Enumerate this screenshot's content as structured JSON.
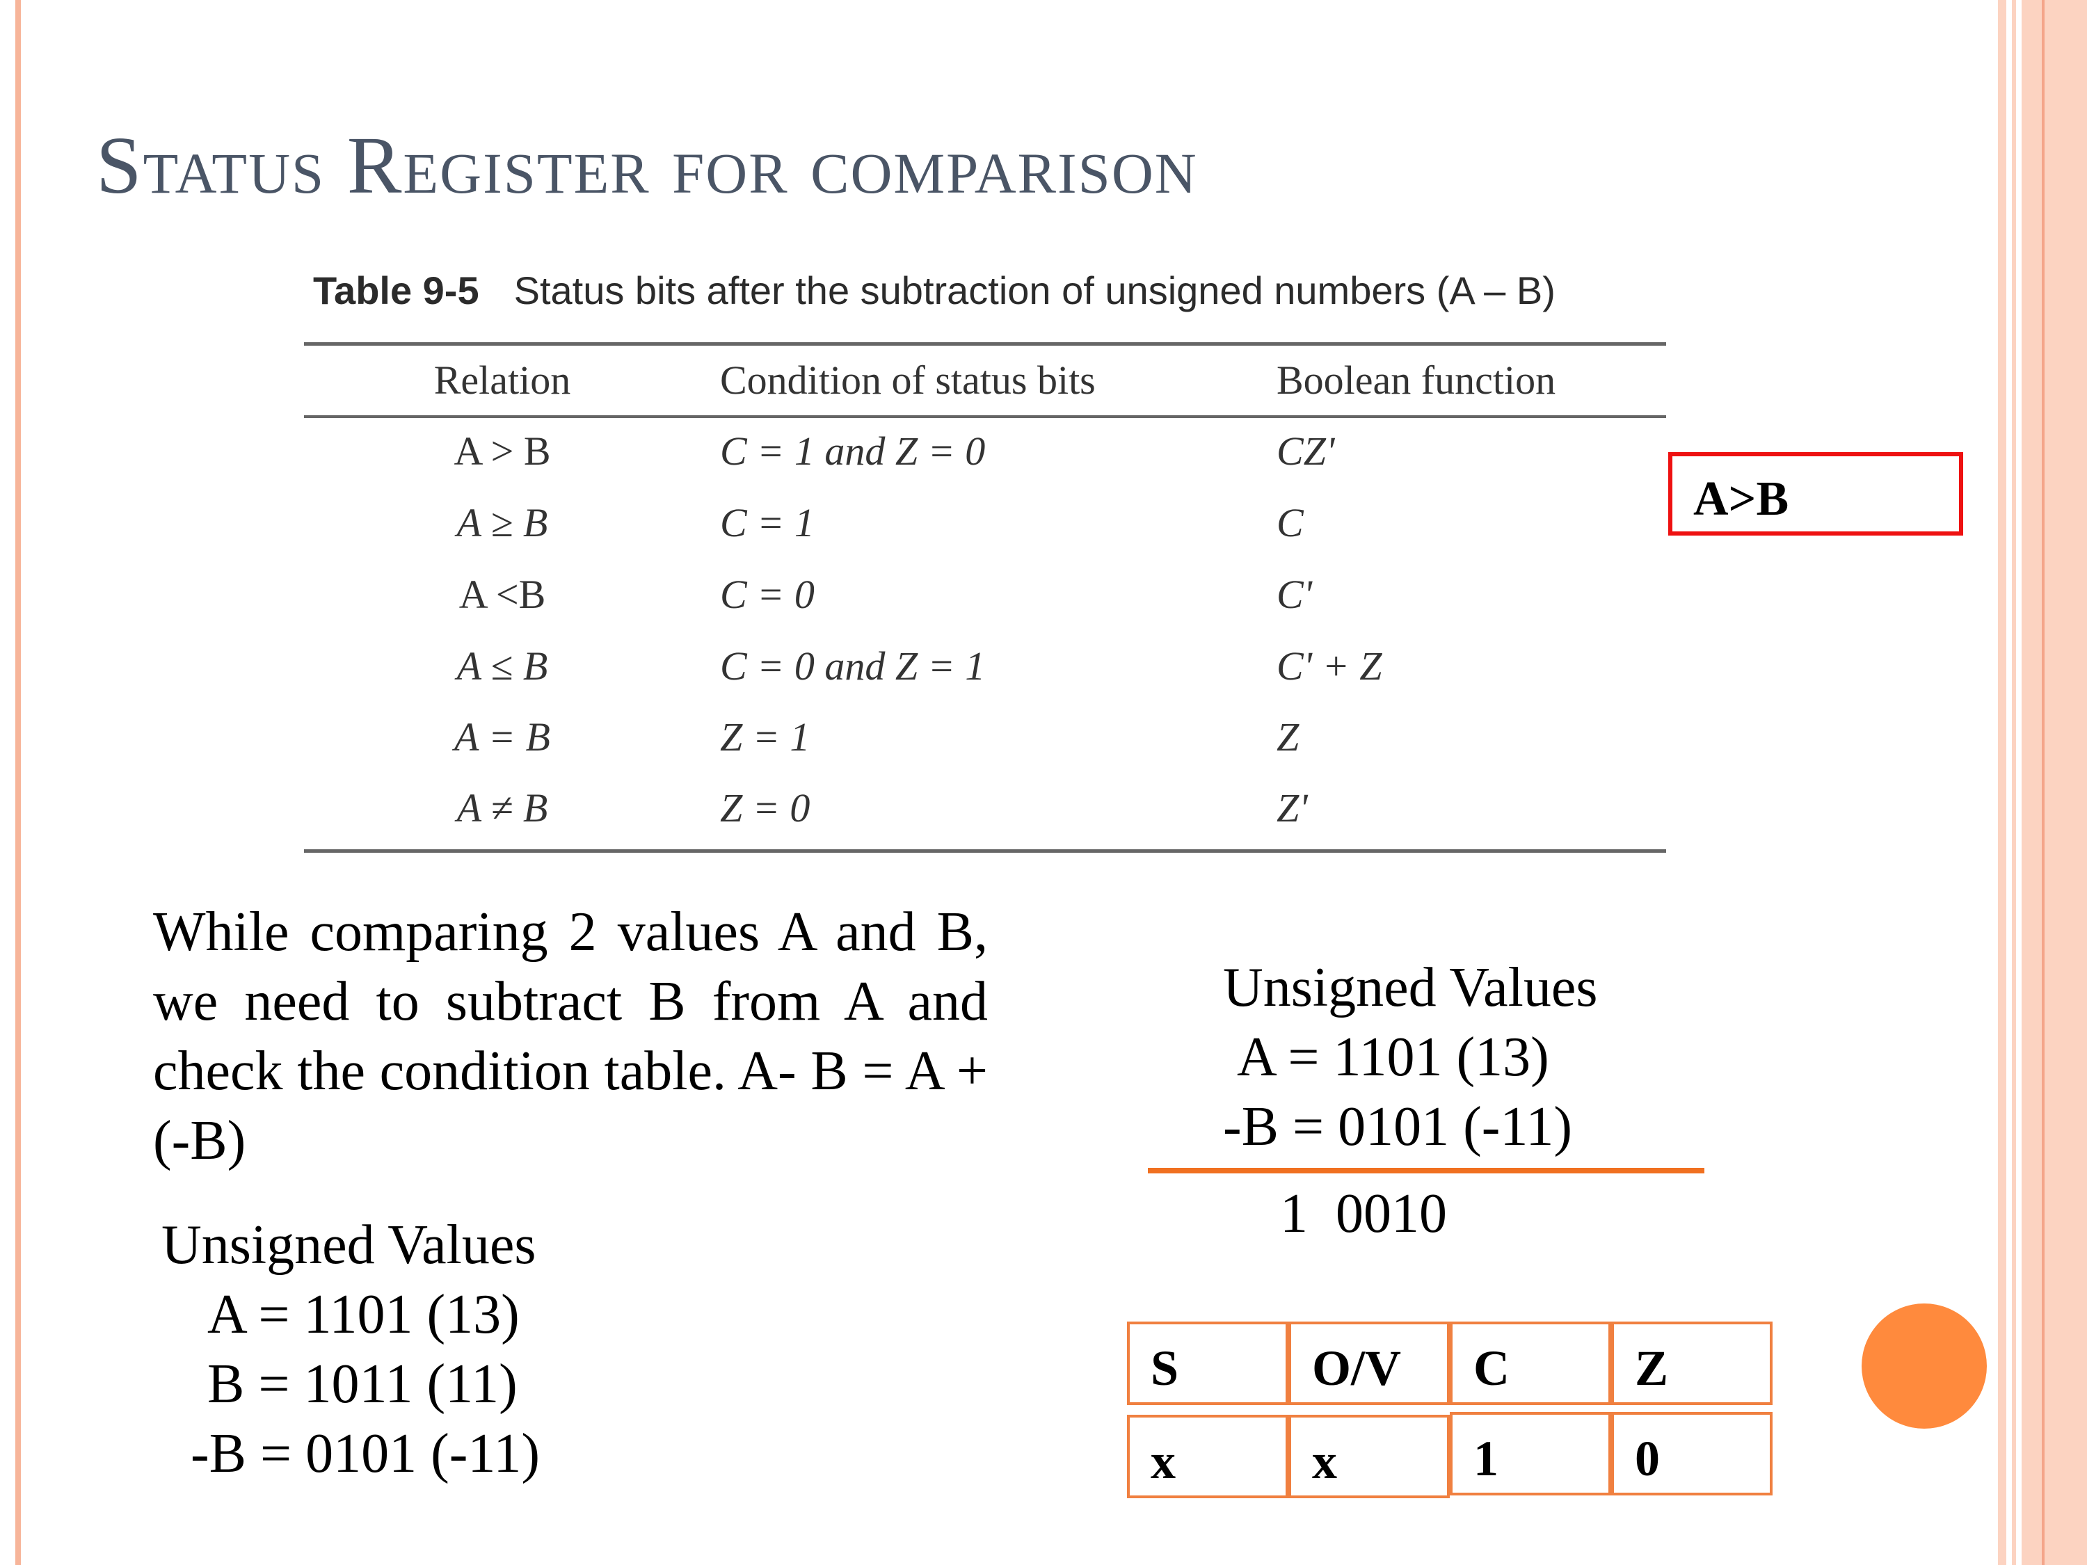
{
  "slide": {
    "title": "Status Register for comparison",
    "table": {
      "caption_number": "Table 9-5",
      "caption_text": "Status bits after the subtraction of unsigned numbers (A – B)",
      "headers": [
        "Relation",
        "Condition of status bits",
        "Boolean function"
      ],
      "rows": [
        {
          "relation": "A > B",
          "condition": "C = 1 and Z = 0",
          "boolean": "CZ'"
        },
        {
          "relation": "A ≥ B",
          "condition": "C = 1",
          "boolean": "C"
        },
        {
          "relation": "A <B",
          "condition": "C = 0",
          "boolean": "C'"
        },
        {
          "relation": "A ≤ B",
          "condition": "C = 0 and Z = 1",
          "boolean": "C' + Z"
        },
        {
          "relation": "A = B",
          "condition": "Z = 1",
          "boolean": "Z"
        },
        {
          "relation": "A ≠ B",
          "condition": "Z = 0",
          "boolean": "Z'"
        }
      ]
    },
    "highlight_label": "A>B",
    "paragraph": "While comparing 2 values A and B, we need to subtract B from A and check the condition table. A- B = A + (-B)",
    "unsigned_left": {
      "heading": "Unsigned Values",
      "lines": [
        "A = 1101 (13)",
        "B = 1011 (11)",
        "-B = 0101 (-11)"
      ]
    },
    "unsigned_right": {
      "heading": "Unsigned Values",
      "lines": [
        "A = 1101 (13)",
        "-B = 0101 (-11)"
      ],
      "result": "1  0010"
    },
    "flags": {
      "headers": [
        "S",
        "O/V",
        "C",
        "Z"
      ],
      "values": [
        "x",
        "x",
        "1",
        "0"
      ]
    }
  }
}
